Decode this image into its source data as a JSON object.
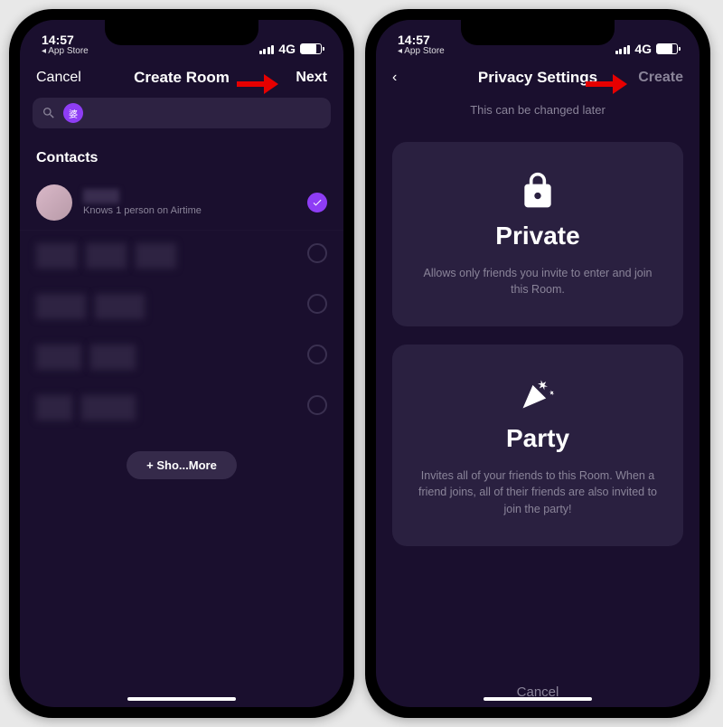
{
  "status": {
    "time": "14:57",
    "back_app": "◂ App Store",
    "network": "4G"
  },
  "left_screen": {
    "nav": {
      "cancel": "Cancel",
      "title": "Create Room",
      "next": "Next"
    },
    "search_chip": "婆",
    "section_header": "Contacts",
    "contact1_sub": "Knows 1 person on Airtime",
    "show_more": "+  Sho...More"
  },
  "right_screen": {
    "nav": {
      "title": "Privacy Settings",
      "create": "Create"
    },
    "subtitle": "This can be changed later",
    "private": {
      "title": "Private",
      "desc": "Allows only friends you invite to enter and join this Room."
    },
    "party": {
      "title": "Party",
      "desc": "Invites all of your friends to this Room. When a friend joins, all of their friends are also invited to join the party!"
    },
    "bottom_cancel": "Cancel"
  }
}
